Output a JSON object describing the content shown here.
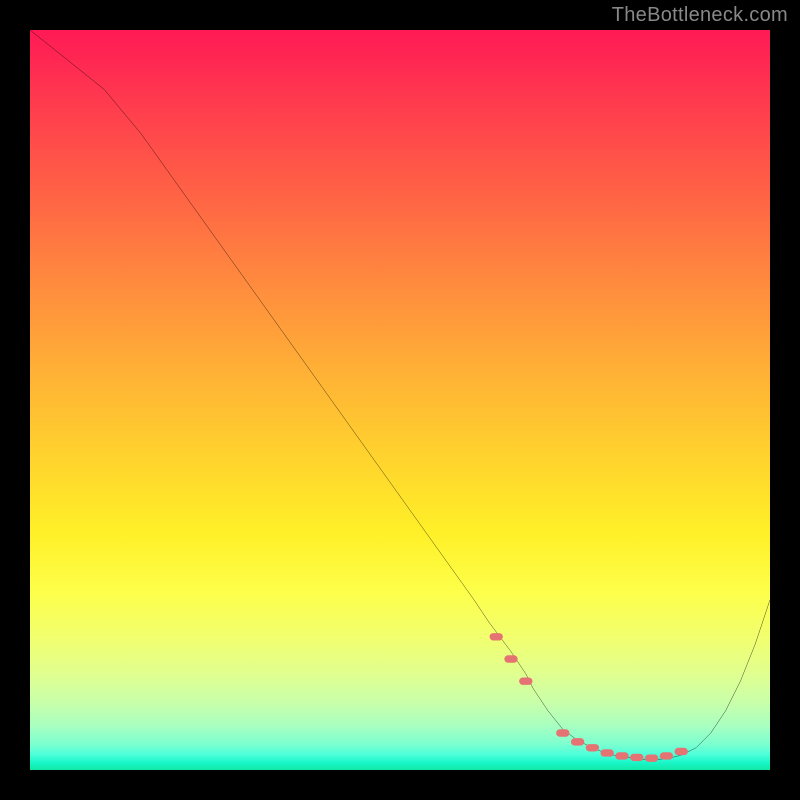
{
  "attribution": "TheBottleneck.com",
  "chart_data": {
    "type": "line",
    "title": "",
    "xlabel": "",
    "ylabel": "",
    "xlim": [
      0,
      100
    ],
    "ylim": [
      0,
      100
    ],
    "x": [
      0,
      5,
      10,
      15,
      20,
      25,
      30,
      35,
      40,
      45,
      50,
      55,
      60,
      62,
      65,
      67,
      68,
      69,
      70,
      72,
      74,
      76,
      78,
      80,
      82,
      84,
      86,
      88,
      90,
      92,
      94,
      96,
      98,
      100
    ],
    "y": [
      100,
      96,
      92,
      86,
      79,
      72,
      65,
      58,
      51,
      44,
      37,
      30,
      23,
      20,
      16,
      13,
      11,
      9.5,
      8,
      5.5,
      4,
      3,
      2.2,
      1.8,
      1.5,
      1.4,
      1.5,
      2,
      3,
      5,
      8,
      12,
      17,
      23
    ],
    "marker_points": {
      "x": [
        63,
        65,
        67,
        72,
        74,
        76,
        78,
        80,
        82,
        84,
        86,
        88
      ],
      "y": [
        18,
        15,
        12,
        5,
        3.8,
        3,
        2.3,
        1.9,
        1.7,
        1.6,
        1.9,
        2.5
      ]
    },
    "background": "rainbow-gradient-vertical",
    "outer_background": "#000000",
    "line_color": "#000000",
    "marker_color": "#e57373"
  }
}
